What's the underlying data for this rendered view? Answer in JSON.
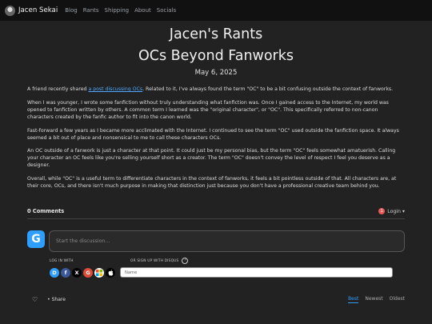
{
  "nav": {
    "site_name": "Jacen Sekai",
    "links": [
      "Blog",
      "Rants",
      "Shipping",
      "About",
      "Socials"
    ]
  },
  "header": {
    "title": "Jacen's Rants",
    "subtitle": "OCs Beyond Fanworks",
    "date": "May 6, 2025"
  },
  "article": {
    "p1_before": "A friend recently shared ",
    "p1_link": "a post discussing OCs",
    "p1_after": ". Related to it, I've always found the term \"OC\" to be a bit confusing outside the context of fanworks.",
    "p2": "When I was younger, I wrote some fanfiction without truly understanding what fanfiction was. Once I gained access to the Internet, my world was opened to fanfiction written by others. A common term I learned was the \"original character\", or \"OC\". This specifically referred to non-canon characters created by the fanfic author to fit into the canon world.",
    "p3": "Fast-forward a few years as I became more acclimated with the Internet. I continued to see the term \"OC\" used outside the fanfiction space. It always seemed a bit out of place and nonsensical to me to call these characters OCs.",
    "p4": "An OC outside of a fanwork is just a character at that point. It could just be my personal bias, but the term \"OC\" feels somewhat amatuerish. Calling your character an OC feels like you're selling yourself short as a creator. The term \"OC\" doesn't convey the level of respect I feel you deserve as a designer.",
    "p5": "Overall, while \"OC\" is a useful term to differentiate characters in the context of fanworks, it feels a bit pointless outside of that. All characters are, at their core, OCs, and there isn't much purpose in making that distinction just because you don't have a professional creative team behind you."
  },
  "comments": {
    "count_label": "0 Comments",
    "login_badge": "1",
    "login_label": "Login ▾",
    "avatar_letter": "G",
    "discuss_placeholder": "Start the discussion…",
    "login_with": "LOG IN WITH",
    "signup_with": "OR SIGN UP WITH DISQUS",
    "help_mark": "?",
    "name_placeholder": "Name",
    "social": [
      {
        "icon": "disqus-icon",
        "glyph": "D",
        "color": "#2e9fff"
      },
      {
        "icon": "facebook-icon",
        "glyph": "f",
        "color": "#3b5998"
      },
      {
        "icon": "x-icon",
        "glyph": "X",
        "color": "#000000"
      },
      {
        "icon": "google-icon",
        "glyph": "G",
        "color": "#dd4b39"
      },
      {
        "icon": "microsoft-icon",
        "glyph": "▦",
        "color": "#4a4a4a"
      },
      {
        "icon": "apple-icon",
        "glyph": "",
        "color": "#000000"
      }
    ],
    "share_label": "Share",
    "sort": [
      "Best",
      "Newest",
      "Oldest"
    ]
  }
}
